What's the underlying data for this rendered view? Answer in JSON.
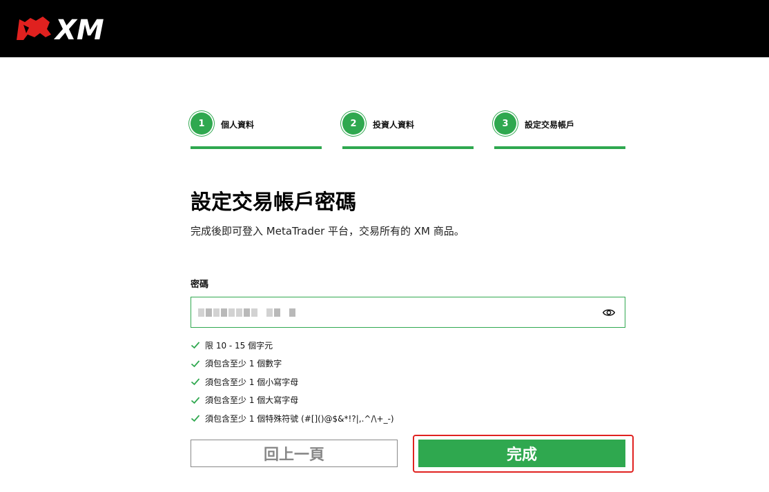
{
  "header": {
    "logo_text": "XM",
    "logo_icon": "xm-bull-logo"
  },
  "steps": [
    {
      "number": "1",
      "label": "個人資料"
    },
    {
      "number": "2",
      "label": "投資人資料"
    },
    {
      "number": "3",
      "label": "設定交易帳戶"
    }
  ],
  "main": {
    "title": "設定交易帳戶密碼",
    "subtitle": "完成後即可登入 MetaTrader 平台，交易所有的 XM 商品。",
    "password_label": "密碼",
    "password_icon": "eye-icon",
    "rules": [
      "限 10 - 15 個字元",
      "須包含至少 1 個數字",
      "須包含至少 1 個小寫字母",
      "須包含至少 1 個大寫字母",
      "須包含至少 1 個特殊符號 (#[]()@$&*!?|,.^/\\+_-)"
    ],
    "rule_icon": "check-icon"
  },
  "buttons": {
    "back_label": "回上一頁",
    "done_label": "完成"
  },
  "colors": {
    "brand_green": "#2fa84f",
    "header_bg": "#000000",
    "highlight_red": "#e0211f"
  }
}
